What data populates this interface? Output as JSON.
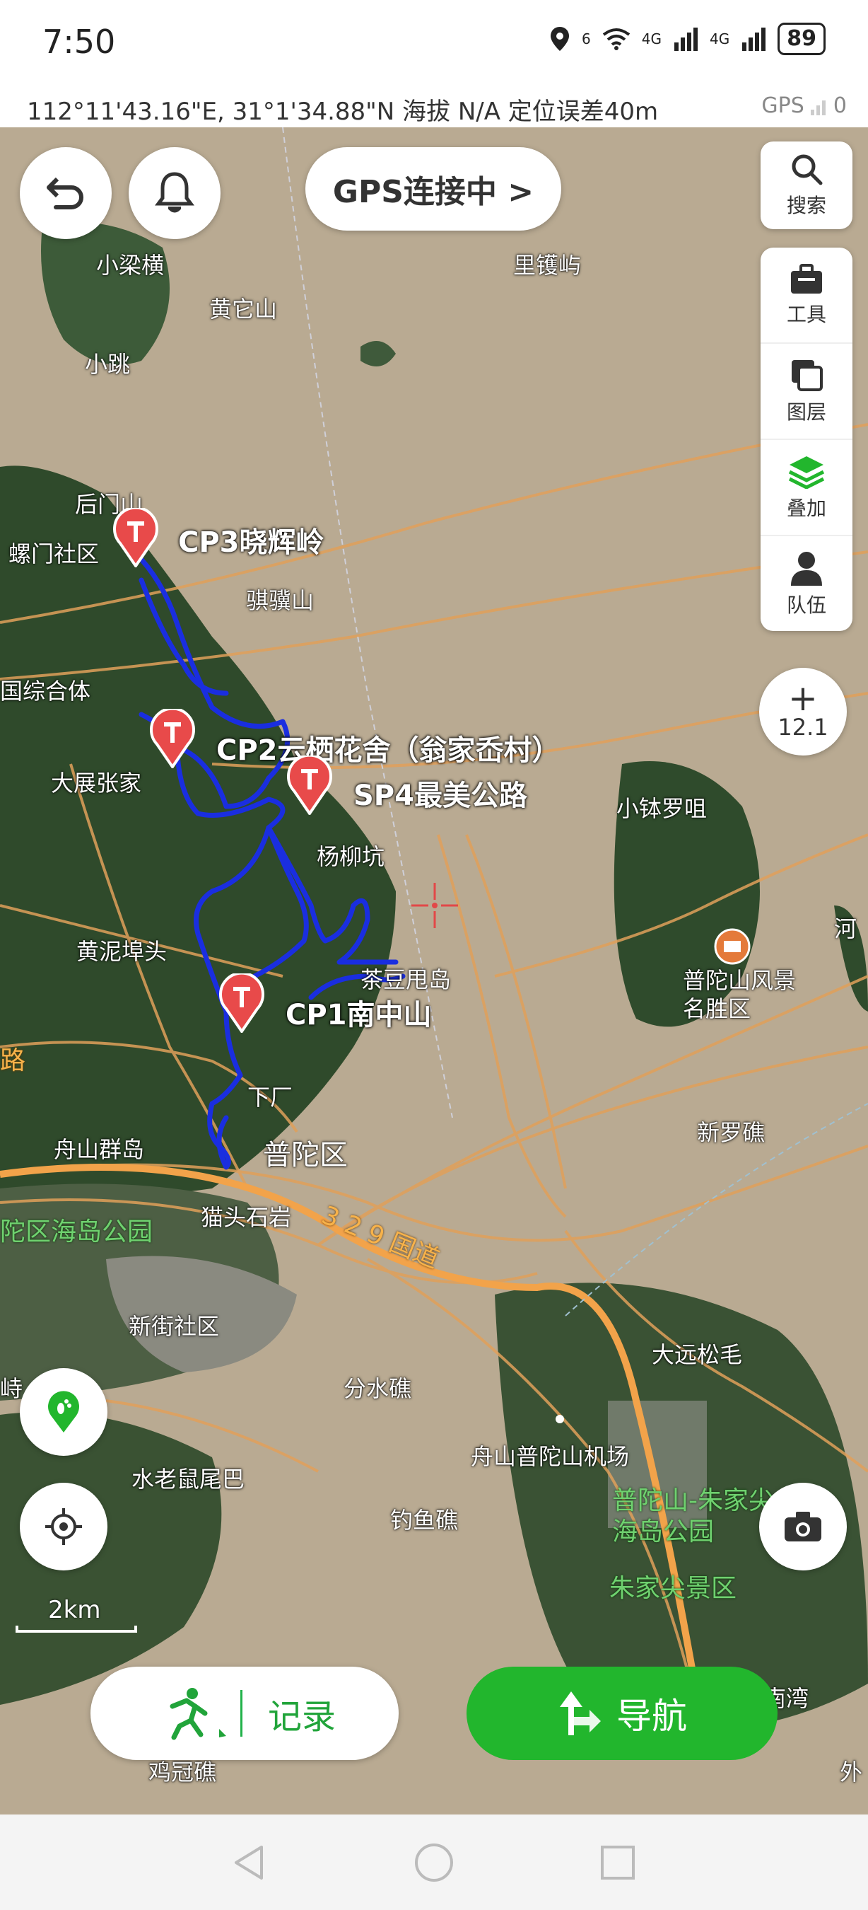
{
  "status_bar": {
    "time": "7:50",
    "network_1": "6",
    "network_2": "4G",
    "network_3": "4G",
    "battery": "89"
  },
  "coord_bar": {
    "coordinates": "112°11'43.16\"E, 31°1'34.88\"N  海拔 N/A  定位误差40m",
    "gps_label": "GPS",
    "gps_count": "0"
  },
  "top_controls": {
    "gps_status": "GPS连接中 >"
  },
  "side_panel": {
    "search": "搜索",
    "tools": "工具",
    "layers": "图层",
    "overlay": "叠加",
    "team": "队伍"
  },
  "zoom": {
    "plus": "+",
    "level": "12.1"
  },
  "scale": "2km",
  "checkpoints": {
    "cp3": "CP3晓辉岭",
    "cp2": "CP2云栖花舍（翁家岙村）",
    "sp4": "SP4最美公路",
    "cp1": "CP1南中山"
  },
  "map_labels": {
    "xiaoliangheng": "小梁横",
    "lihuoyu": "里镬屿",
    "huangtashan": "黄它山",
    "xiaotiao": "小跳",
    "houmenshan": "后门山",
    "luomen": "螺门社区",
    "qijishan": "骐骥山",
    "zonghe": "国综合体",
    "dazhan": "大展张家",
    "yangliukeng": "杨柳坑",
    "xiaoboluo": "小钵罗咀",
    "huangnibu": "黄泥埠头",
    "chadou": "茶豆甩岛",
    "putuoshan": "普陀山风景名胜区",
    "he": "河",
    "lu": "路",
    "xiachang": "下厂",
    "xinluojiao": "新罗礁",
    "zhoushanqundao": "舟山群岛",
    "putuoqu": "普陀区",
    "maotoushiyan": "猫头石岩",
    "guodao": "3 2 9 国道",
    "haidaogongyuan": "陀区海岛公园",
    "xinjie": "新街社区",
    "dayuansonggen": "大远松毛",
    "fenshuijiao": "分水礁",
    "xia": "峙",
    "airport": "舟山普陀山机场",
    "shuilaoshu": "水老鼠尾巴",
    "diaoyujiao": "钓鱼礁",
    "zhujiajian": "普陀山-朱家尖海岛公园",
    "zhujiajianjq": "朱家尖景区",
    "nanwan": "南湾",
    "jiguanjiao": "鸡冠礁",
    "wai": "外"
  },
  "bottom": {
    "record": "记录",
    "navigate": "导航"
  },
  "colors": {
    "brand_green": "#22b62d",
    "track_blue": "#1a2ee0",
    "marker_red": "#e84a4a"
  }
}
